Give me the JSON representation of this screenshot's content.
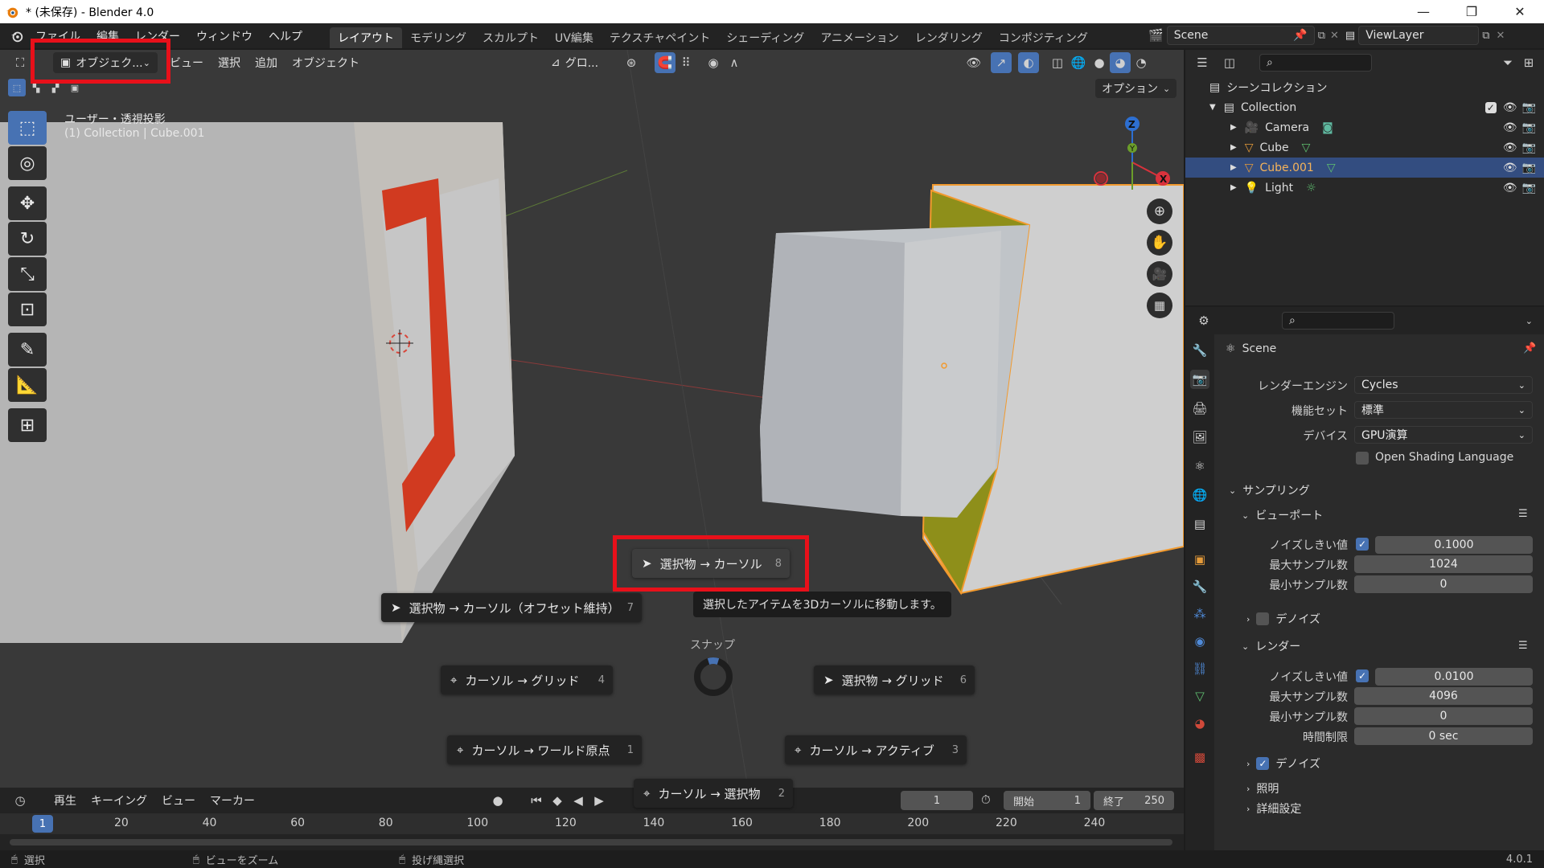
{
  "window": {
    "title": "* (未保存) - Blender 4.0",
    "minimize": "—",
    "maximize": "❐",
    "close": "✕"
  },
  "topbar": {
    "menus": [
      "ファイル",
      "編集",
      "レンダー",
      "ウィンドウ",
      "ヘルプ"
    ],
    "tabs": [
      "レイアウト",
      "モデリング",
      "スカルプト",
      "UV編集",
      "テクスチャペイント",
      "シェーディング",
      "アニメーション",
      "レンダリング",
      "コンポジティング"
    ],
    "scene": "Scene",
    "view_layer": "ViewLayer"
  },
  "viewport_header": {
    "mode": "オブジェク...",
    "menus": [
      "ビュー",
      "選択",
      "追加",
      "オブジェクト"
    ],
    "transform_orientation": "グロ...",
    "options": "オプション"
  },
  "viewport": {
    "view_name": "ユーザー・透視投影",
    "context": "(1) Collection | Cube.001"
  },
  "pie_menu": {
    "title": "スナップ",
    "items": [
      {
        "label": "選択物 → カーソル",
        "key": "8"
      },
      {
        "label": "選択物 → カーソル（オフセット維持）",
        "key": "7"
      },
      {
        "label": "カーソル → グリッド",
        "key": "4"
      },
      {
        "label": "選択物 → グリッド",
        "key": "6"
      },
      {
        "label": "カーソル → ワールド原点",
        "key": "1"
      },
      {
        "label": "カーソル → アクティブ",
        "key": "3"
      },
      {
        "label": "カーソル → 選択物",
        "key": "2"
      }
    ],
    "tooltip": "選択したアイテムを3Dカーソルに移動します。"
  },
  "timeline": {
    "menus": [
      "再生",
      "キーイング",
      "ビュー",
      "マーカー"
    ],
    "current_frame": "1",
    "start_label": "開始",
    "start": "1",
    "end_label": "終了",
    "end": "250",
    "ticks": [
      "20",
      "40",
      "60",
      "80",
      "100",
      "120",
      "140",
      "160",
      "180",
      "200",
      "220",
      "240"
    ],
    "playhead": "1"
  },
  "status": {
    "select": "選択",
    "zoom": "ビューをズーム",
    "lasso": "投げ縄選択",
    "version": "4.0.1"
  },
  "outliner": {
    "scene_collection": "シーンコレクション",
    "collection": "Collection",
    "items": [
      "Camera",
      "Cube",
      "Cube.001",
      "Light"
    ]
  },
  "properties": {
    "scene": "Scene",
    "render_engine_label": "レンダーエンジン",
    "render_engine": "Cycles",
    "feature_set_label": "機能セット",
    "feature_set": "標準",
    "device_label": "デバイス",
    "device": "GPU演算",
    "osl": "Open Shading Language",
    "sampling": "サンプリング",
    "viewport": "ビューポート",
    "noise_threshold_label": "ノイズしきい値",
    "vp_noise_threshold": "0.1000",
    "max_samples_label": "最大サンプル数",
    "vp_max_samples": "1024",
    "min_samples_label": "最小サンプル数",
    "vp_min_samples": "0",
    "denoise": "デノイズ",
    "render": "レンダー",
    "r_noise_threshold": "0.0100",
    "r_max_samples": "4096",
    "r_min_samples": "0",
    "time_limit_label": "時間制限",
    "time_limit": "0 sec",
    "denoise2": "デノイズ",
    "lighting": "照明",
    "advanced": "詳細設定"
  }
}
